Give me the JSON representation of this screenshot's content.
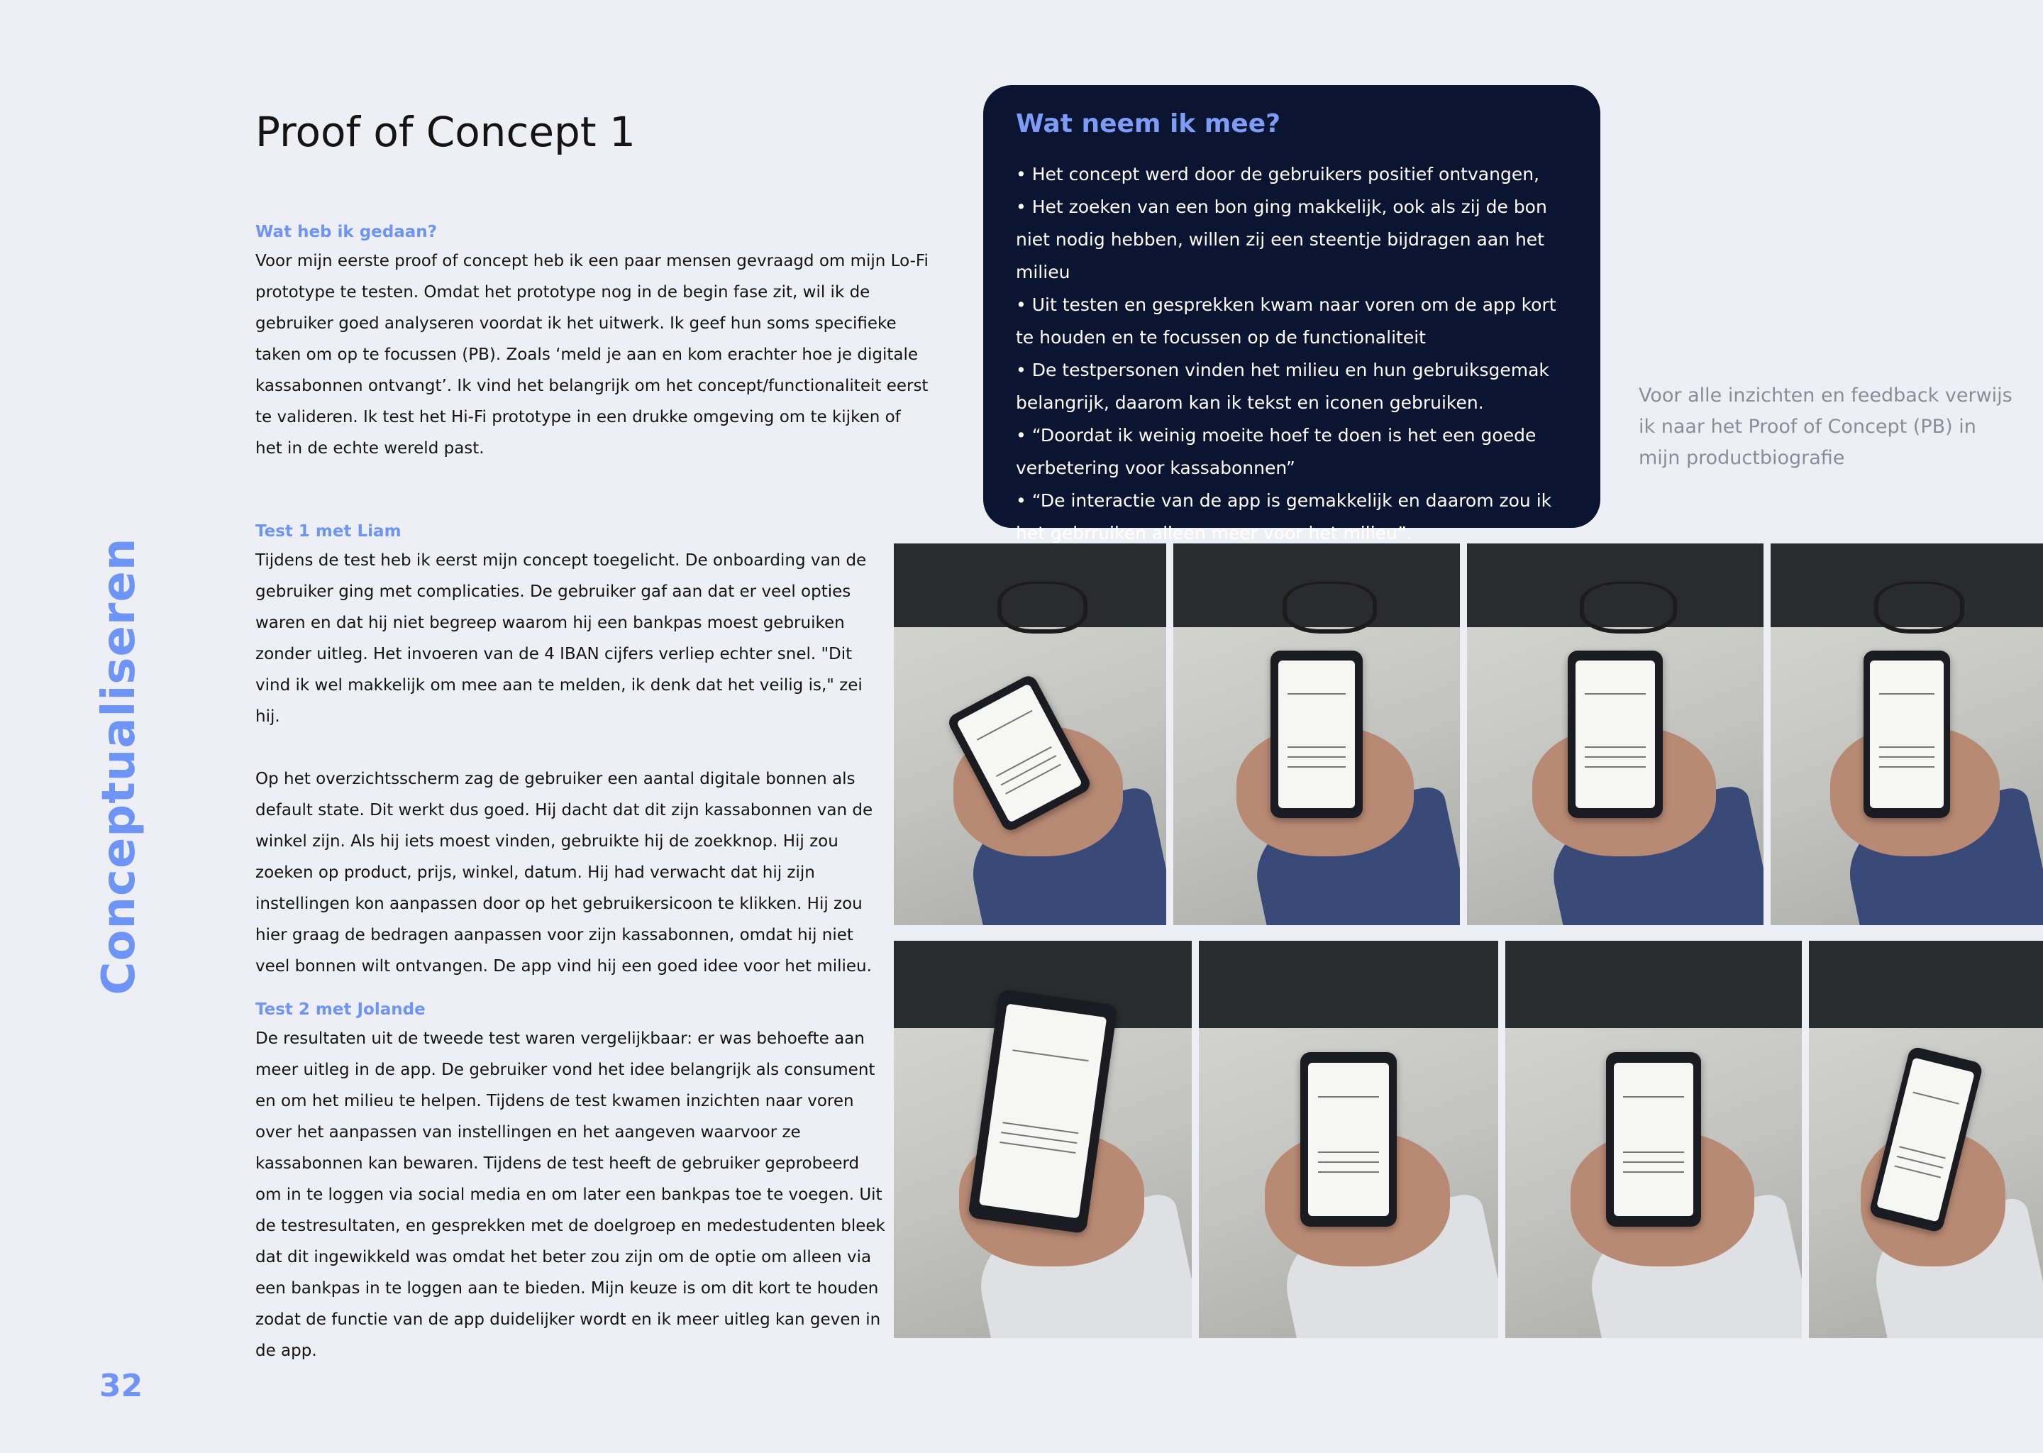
{
  "page": {
    "side_label": "Conceptualiseren",
    "page_number": "32"
  },
  "title": "Proof of Concept 1",
  "sections": [
    {
      "heading": "Wat heb ik gedaan?",
      "paragraphs": [
        "Voor mijn eerste proof of concept heb ik een paar mensen gevraagd om mijn Lo-Fi prototype te testen. Omdat het prototype nog in de begin fase zit, wil ik de gebruiker goed analyseren voordat ik het uitwerk. Ik geef hun soms specifieke taken om op te focussen (PB). Zoals ‘meld je aan en kom erachter hoe je digitale kassabonnen ontvangt’. Ik vind het belangrijk om het concept/functionaliteit eerst te valideren. Ik test het Hi-Fi prototype in een drukke omgeving om te kijken of het in de echte wereld past."
      ]
    },
    {
      "heading": "Test 1 met Liam",
      "paragraphs": [
        "Tijdens de test heb ik eerst mijn concept toegelicht. De onboarding van de gebruiker ging met complicaties. De gebruiker gaf aan dat er veel opties waren en dat hij niet begreep waarom hij een bankpas moest gebruiken zonder uitleg. Het invoeren van de 4 IBAN cijfers verliep echter snel. \"Dit vind ik wel makkelijk om mee aan te melden, ik denk dat het veilig is,\" zei hij.",
        "Op het overzichtsscherm zag de gebruiker een aantal digitale bonnen als default state. Dit werkt dus goed. Hij dacht dat dit zijn kassabonnen van de winkel zijn. Als hij iets moest vinden, gebruikte hij de zoekknop. Hij zou zoeken op product, prijs, winkel,  datum. Hij had verwacht dat hij zijn instellingen kon aanpassen door op het gebruikersicoon te klikken. Hij zou hier graag de bedragen aanpassen voor zijn kassabonnen, omdat hij niet veel bonnen wilt ontvangen. De app vind hij een goed idee voor het milieu."
      ]
    },
    {
      "heading": "Test 2 met Jolande",
      "paragraphs": [
        "De resultaten uit de tweede test waren vergelijkbaar: er was behoefte aan meer uitleg in de app. De gebruiker vond het idee belangrijk als consument en om het milieu te helpen. Tijdens de test kwamen inzichten naar voren over het aanpassen van instellingen en het aangeven waarvoor ze kassabonnen kan bewaren. Tijdens de test heeft de gebruiker geprobeerd om in te loggen via social media en om later een bankpas toe te voegen. Uit de testresultaten, en gesprekken met de doelgroep en medestudenten bleek dat dit ingewikkeld was omdat het beter zou zijn om de optie om alleen via een bankpas in te loggen aan te bieden. Mijn keuze is om dit kort te houden zodat de functie van de app duidelijker wordt en ik meer uitleg kan geven in de app."
      ]
    }
  ],
  "callout": {
    "title": "Wat neem ik mee?",
    "items": [
      "Het concept werd door de gebruikers  positief ontvangen,",
      "Het zoeken van een bon ging makkelijk, ook als zij de bon niet nodig hebben, willen zij een steentje bijdragen aan het milieu",
      "Uit testen en gesprekken kwam naar voren om de app kort te houden en te focussen op de functionaliteit",
      "De testpersonen vinden het milieu en hun gebruiksgemak belangrijk, daarom kan ik tekst en iconen gebruiken.",
      "“Doordat ik weinig moeite hoef te doen is het een goede verbetering voor kassabonnen”",
      "“De interactie van de app is gemakkelijk en daarom zou ik het gebrruiken alleen meer voor het milieu”."
    ]
  },
  "reference_note": "Voor alle inzichten en feedback verwijs ik naar het Proof of Concept (PB) in mijn productbiografie",
  "colors": {
    "accent": "#6e95f5",
    "callout_bg": "#0b1532",
    "page_bg": "#eeeff4",
    "note_text": "#8a8d99"
  }
}
